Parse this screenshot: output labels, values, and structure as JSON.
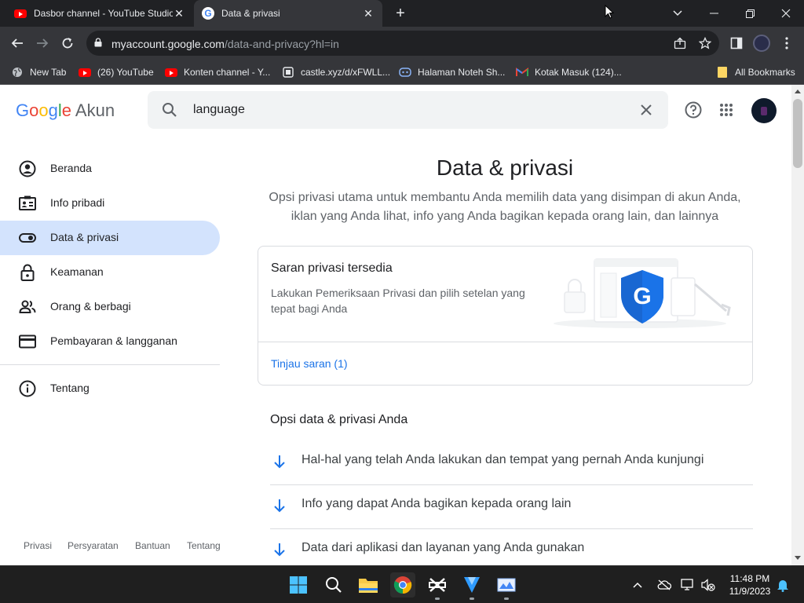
{
  "browser": {
    "tabs": [
      {
        "title": "Dasbor channel - YouTube Studio",
        "icon": "youtube-icon",
        "active": false
      },
      {
        "title": "Data & privasi",
        "icon": "google-icon",
        "active": true
      }
    ],
    "new_tab": "+",
    "url_host": "myaccount.google.com",
    "url_path": "/data-and-privacy?hl=in",
    "bookmarks": [
      {
        "label": "New Tab",
        "icon": "globe-icon"
      },
      {
        "label": "(26) YouTube",
        "icon": "youtube-icon"
      },
      {
        "label": "Konten channel - Y...",
        "icon": "youtube-icon"
      },
      {
        "label": "castle.xyz/d/xFWLL...",
        "icon": "castle-icon"
      },
      {
        "label": "Halaman Noteh Sh...",
        "icon": "discord-icon"
      },
      {
        "label": "Kotak Masuk (124)...",
        "icon": "gmail-icon"
      }
    ],
    "all_bookmarks": "All Bookmarks"
  },
  "header": {
    "logo_google": "Google",
    "logo_product": "Akun",
    "search_value": "language"
  },
  "sidebar": {
    "items": [
      {
        "label": "Beranda",
        "icon": "account-circle-icon"
      },
      {
        "label": "Info pribadi",
        "icon": "id-card-icon"
      },
      {
        "label": "Data & privasi",
        "icon": "toggle-icon",
        "active": true
      },
      {
        "label": "Keamanan",
        "icon": "lock-icon"
      },
      {
        "label": "Orang & berbagi",
        "icon": "people-icon"
      },
      {
        "label": "Pembayaran & langganan",
        "icon": "credit-card-icon"
      },
      {
        "label": "Tentang",
        "icon": "info-icon"
      }
    ],
    "footer": [
      "Privasi",
      "Persyaratan",
      "Bantuan",
      "Tentang"
    ]
  },
  "main": {
    "title": "Data & privasi",
    "subtitle": "Opsi privasi utama untuk membantu Anda memilih data yang disimpan di akun Anda, iklan yang Anda lihat, info yang Anda bagikan kepada orang lain, dan lainnya",
    "card": {
      "title": "Saran privasi tersedia",
      "desc": "Lakukan Pemeriksaan Privasi dan pilih setelan yang tepat bagi Anda",
      "link": "Tinjau saran (1)",
      "shield_letter": "G"
    },
    "section_title": "Opsi data & privasi Anda",
    "options": [
      "Hal-hal yang telah Anda lakukan dan tempat yang pernah Anda kunjungi",
      "Info yang dapat Anda bagikan kepada orang lain",
      "Data dari aplikasi dan layanan yang Anda gunakan"
    ]
  },
  "taskbar": {
    "time": "11:48 PM",
    "date": "11/9/2023"
  },
  "colors": {
    "accent": "#1a73e8",
    "nav_active": "#d3e3fd",
    "browser_dark": "#202124",
    "toolbar": "#35363a"
  }
}
